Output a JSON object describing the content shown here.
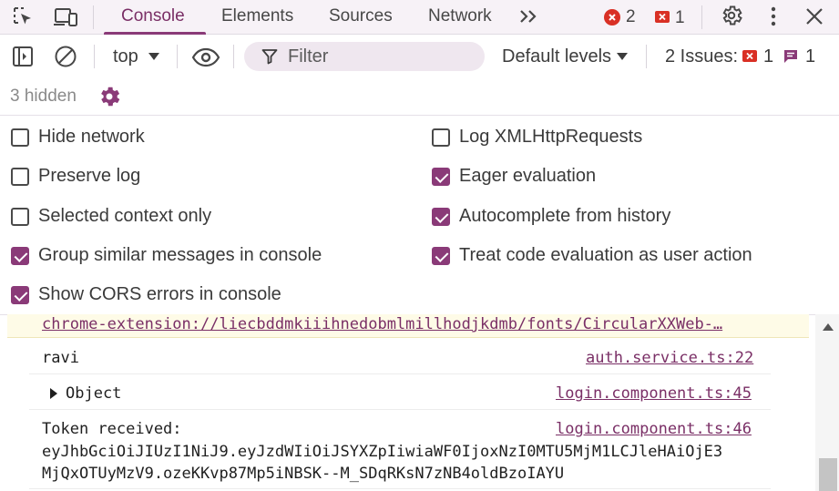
{
  "tabs": {
    "items": [
      "Console",
      "Elements",
      "Sources",
      "Network"
    ],
    "active": "Console",
    "error_count": "2",
    "warning_count": "1"
  },
  "toolbar": {
    "context": "top",
    "filter_placeholder": "Filter",
    "levels": "Default levels",
    "issues_label": "2 Issues:",
    "issues_errors": "1",
    "issues_info": "1",
    "hidden": "3 hidden"
  },
  "settings": {
    "left": [
      {
        "label": "Hide network",
        "checked": false
      },
      {
        "label": "Preserve log",
        "checked": false
      },
      {
        "label": "Selected context only",
        "checked": false
      },
      {
        "label": "Group similar messages in console",
        "checked": true
      },
      {
        "label": "Show CORS errors in console",
        "checked": true
      }
    ],
    "right": [
      {
        "label": "Log XMLHttpRequests",
        "checked": false
      },
      {
        "label": "Eager evaluation",
        "checked": true
      },
      {
        "label": "Autocomplete from history",
        "checked": true
      },
      {
        "label": "Treat code evaluation as user action",
        "checked": true
      }
    ]
  },
  "console": {
    "warning_url": "chrome-extension://liecbddmkiiihnedobmlmillhodjkdmb/fonts/CircularXXWeb-…",
    "messages": [
      {
        "text": "ravi",
        "source": "auth.service.ts:22"
      },
      {
        "text": "Object",
        "source": "login.component.ts:45"
      },
      {
        "text": "Token received:",
        "source": "login.component.ts:46"
      }
    ],
    "token_line1": "eyJhbGciOiJIUzI1NiJ9.eyJzdWIiOiJSYXZpIiwiaWF0IjoxNzI0MTU5MjM1LCJleHAiOjE3",
    "token_line2": "MjQxOTUyMzV9.ozeKKvp87Mp5iNBSK--M_SDqRKsN7zNB4oldBzoIAYU"
  },
  "colors": {
    "accent": "#8a3a78",
    "error": "#d93025",
    "warning_bg": "#fefbe7"
  }
}
